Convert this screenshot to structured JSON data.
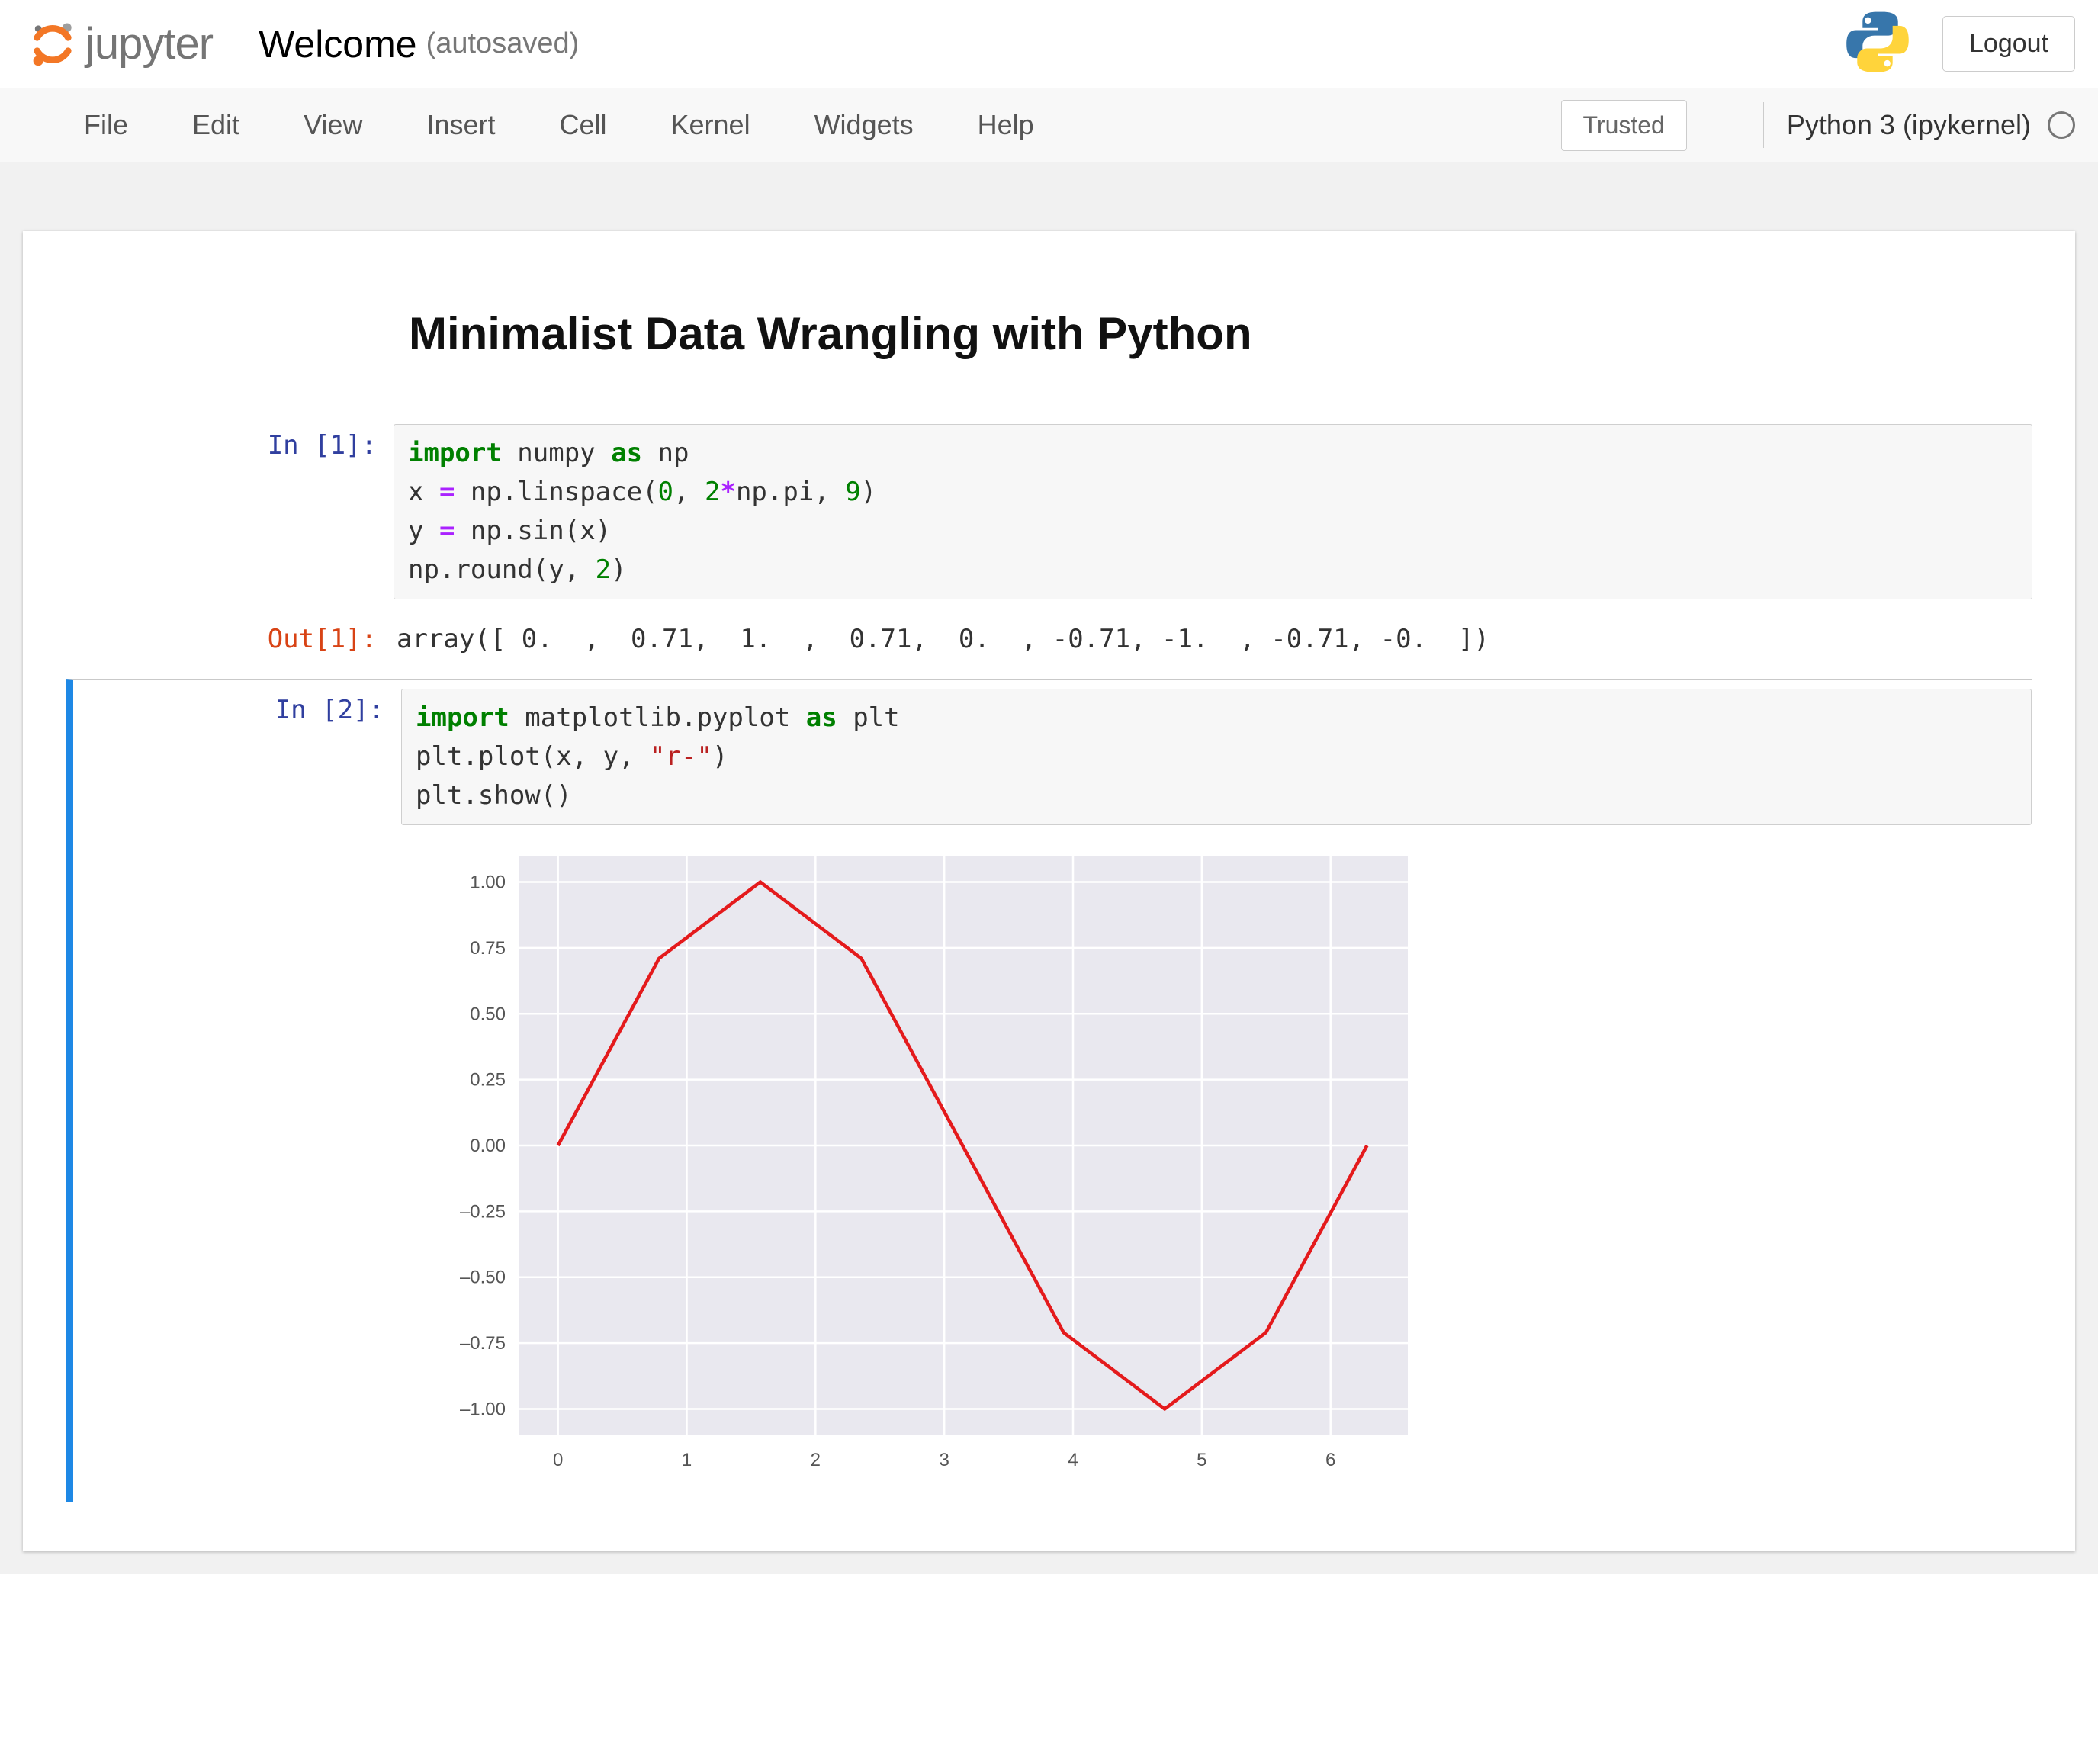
{
  "header": {
    "brand": "jupyter",
    "notebook_name": "Welcome",
    "autosave": "(autosaved)",
    "logout": "Logout"
  },
  "menubar": {
    "items": [
      "File",
      "Edit",
      "View",
      "Insert",
      "Cell",
      "Kernel",
      "Widgets",
      "Help"
    ],
    "trusted": "Trusted",
    "kernel": "Python 3 (ipykernel)"
  },
  "cells": {
    "md_heading": "Minimalist Data Wrangling with Python",
    "in1_prompt": "In [1]:",
    "in1_code_tokens": [
      [
        "kw",
        "import"
      ],
      [
        "nm",
        " numpy "
      ],
      [
        "kw",
        "as"
      ],
      [
        "nm",
        " np"
      ],
      [
        "br",
        ""
      ],
      [
        "nm",
        "x "
      ],
      [
        "op",
        "="
      ],
      [
        "nm",
        " np.linspace("
      ],
      [
        "num",
        "0"
      ],
      [
        "nm",
        ", "
      ],
      [
        "num",
        "2"
      ],
      [
        "op",
        "*"
      ],
      [
        "nm",
        "np.pi, "
      ],
      [
        "num",
        "9"
      ],
      [
        "nm",
        ")"
      ],
      [
        "br",
        ""
      ],
      [
        "nm",
        "y "
      ],
      [
        "op",
        "="
      ],
      [
        "nm",
        " np.sin(x)"
      ],
      [
        "br",
        ""
      ],
      [
        "nm",
        "np.round(y, "
      ],
      [
        "num",
        "2"
      ],
      [
        "nm",
        ")"
      ]
    ],
    "out1_prompt": "Out[1]:",
    "out1_text": "array([ 0.  ,  0.71,  1.  ,  0.71,  0.  , -0.71, -1.  , -0.71, -0.  ])",
    "in2_prompt": "In [2]:",
    "in2_code_tokens": [
      [
        "kw",
        "import"
      ],
      [
        "nm",
        " matplotlib.pyplot "
      ],
      [
        "kw",
        "as"
      ],
      [
        "nm",
        " plt"
      ],
      [
        "br",
        ""
      ],
      [
        "nm",
        "plt.plot(x, y, "
      ],
      [
        "str",
        "\"r-\""
      ],
      [
        "nm",
        ")"
      ],
      [
        "br",
        ""
      ],
      [
        "nm",
        "plt.show()"
      ]
    ]
  },
  "chart_data": {
    "type": "line",
    "x": [
      0,
      0.785,
      1.571,
      2.356,
      3.142,
      3.927,
      4.712,
      5.498,
      6.283
    ],
    "y": [
      0,
      0.71,
      1.0,
      0.71,
      0,
      -0.71,
      -1.0,
      -0.71,
      0
    ],
    "color": "#e41a1c",
    "xlim": [
      -0.3,
      6.6
    ],
    "ylim": [
      -1.1,
      1.1
    ],
    "xticks": [
      0,
      1,
      2,
      3,
      4,
      5,
      6
    ],
    "yticks": [
      -1.0,
      -0.75,
      -0.5,
      -0.25,
      0.0,
      0.25,
      0.5,
      0.75,
      1.0
    ],
    "ytick_labels": [
      "–1.00",
      "–0.75",
      "–0.50",
      "–0.25",
      "0.00",
      "0.25",
      "0.50",
      "0.75",
      "1.00"
    ]
  }
}
